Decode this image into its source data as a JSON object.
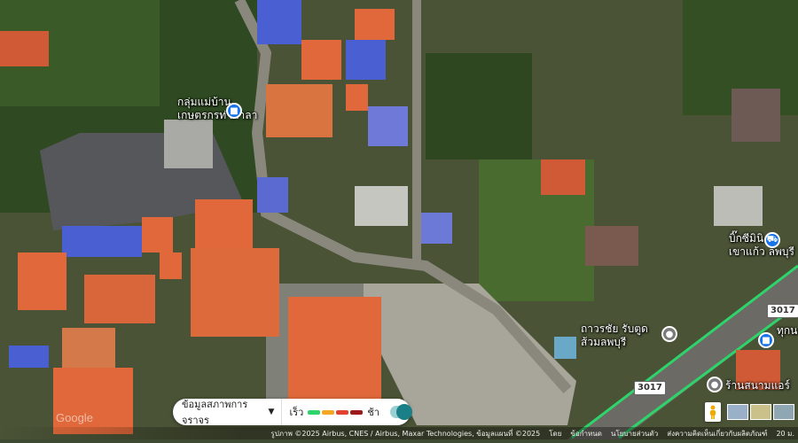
{
  "map": {
    "type": "satellite",
    "labels": {
      "community_group": [
        "กลุ่มแม่บ้าน",
        "เกษตรกรท่าศาลา"
      ],
      "shop_1": [
        "บิ๊กซีมินิ",
        "เขาแก้ว ลพบุรี"
      ],
      "tire_shop": [
        "ถาวรชัย รับตูด",
        "ส้วมลพบุรี"
      ],
      "shop_2_line1": "ทุกน",
      "shop_3_line1": "ร้านสนามแอร์"
    },
    "road_shields": [
      "3017",
      "3017"
    ],
    "watermark": "Google",
    "colors": {
      "highway": "#2fd36b",
      "roof_orange": "#e0683a",
      "roof_blue": "#4a5fd1",
      "pin_blue": "#1a73e8",
      "pin_gray": "#7a7a7a"
    }
  },
  "traffic": {
    "dropdown_label": "ข้อมูลสภาพการจราจร",
    "fast_label": "เร็ว",
    "slow_label": "ช้า",
    "legend_colors": [
      "#2fd36b",
      "#f5a623",
      "#e2412f",
      "#9b1b1b"
    ]
  },
  "attribution": {
    "imagery": "รูปภาพ ©2025 Airbus, CNES / Airbus, Maxar Technologies, ข้อมูลแผนที่ ©2025",
    "terms": "โดย",
    "privacy": "ข้อกำหนด",
    "feedback": "นโยบายส่วนตัว",
    "report": "ส่งความคิดเห็นเกี่ยวกับผลิตภัณฑ์",
    "scale": "20 ม."
  },
  "icons": [
    "lock-pin-icon",
    "cart-pin-icon",
    "place-pin-icon",
    "pegman-icon",
    "layers-icon",
    "caret-down-icon"
  ]
}
